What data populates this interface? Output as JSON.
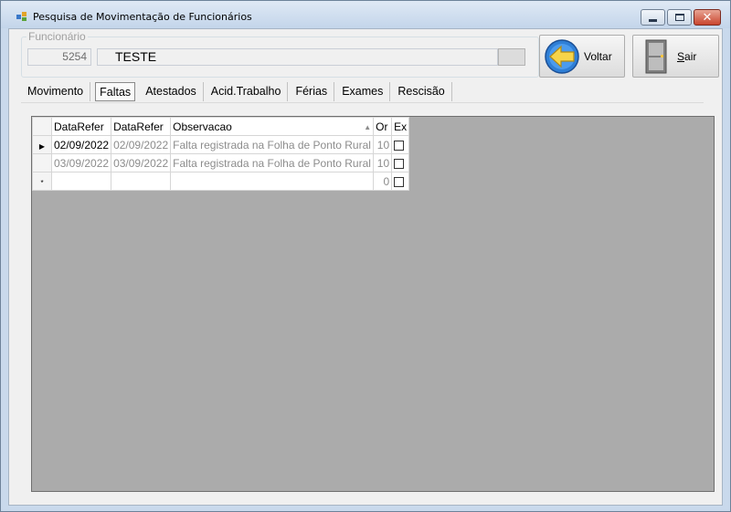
{
  "window": {
    "title": "Pesquisa de Movimentação de Funcionários",
    "controls": {
      "minimize_icon": "minimize-icon",
      "maximize_icon": "maximize-icon",
      "close_glyph": "✕"
    }
  },
  "employee": {
    "group_label": "Funcionário",
    "code": "5254",
    "name": "TESTE"
  },
  "buttons": {
    "voltar": {
      "label": "Voltar",
      "icon": "arrow-left-icon"
    },
    "sair": {
      "label": "Sair",
      "icon": "exit-door-icon"
    }
  },
  "tabs": [
    {
      "label": "Movimento",
      "active": false
    },
    {
      "label": "Faltas",
      "active": true
    },
    {
      "label": "Atestados",
      "active": false
    },
    {
      "label": "Acid.Trabalho",
      "active": false
    },
    {
      "label": "Férias",
      "active": false
    },
    {
      "label": "Exames",
      "active": false
    },
    {
      "label": "Rescisão",
      "active": false
    }
  ],
  "grid": {
    "columns": [
      "DataRefer",
      "DataRefer",
      "Observacao",
      "Or",
      "Ex"
    ],
    "rows": [
      {
        "indicator": "▶",
        "c1": "02/09/2022",
        "c2": "02/09/2022",
        "obs": "Falta registrada na Folha de Ponto Rural",
        "or": "10",
        "ex": false
      },
      {
        "indicator": "",
        "c1": "03/09/2022",
        "c2": "03/09/2022",
        "obs": "Falta registrada na Folha de Ponto Rural",
        "or": "10",
        "ex": false
      }
    ],
    "new_row": {
      "indicator": "*",
      "or": "0"
    },
    "colors": {
      "empty_area": "#ababab",
      "disabled_text": "#8c8c8c"
    }
  }
}
